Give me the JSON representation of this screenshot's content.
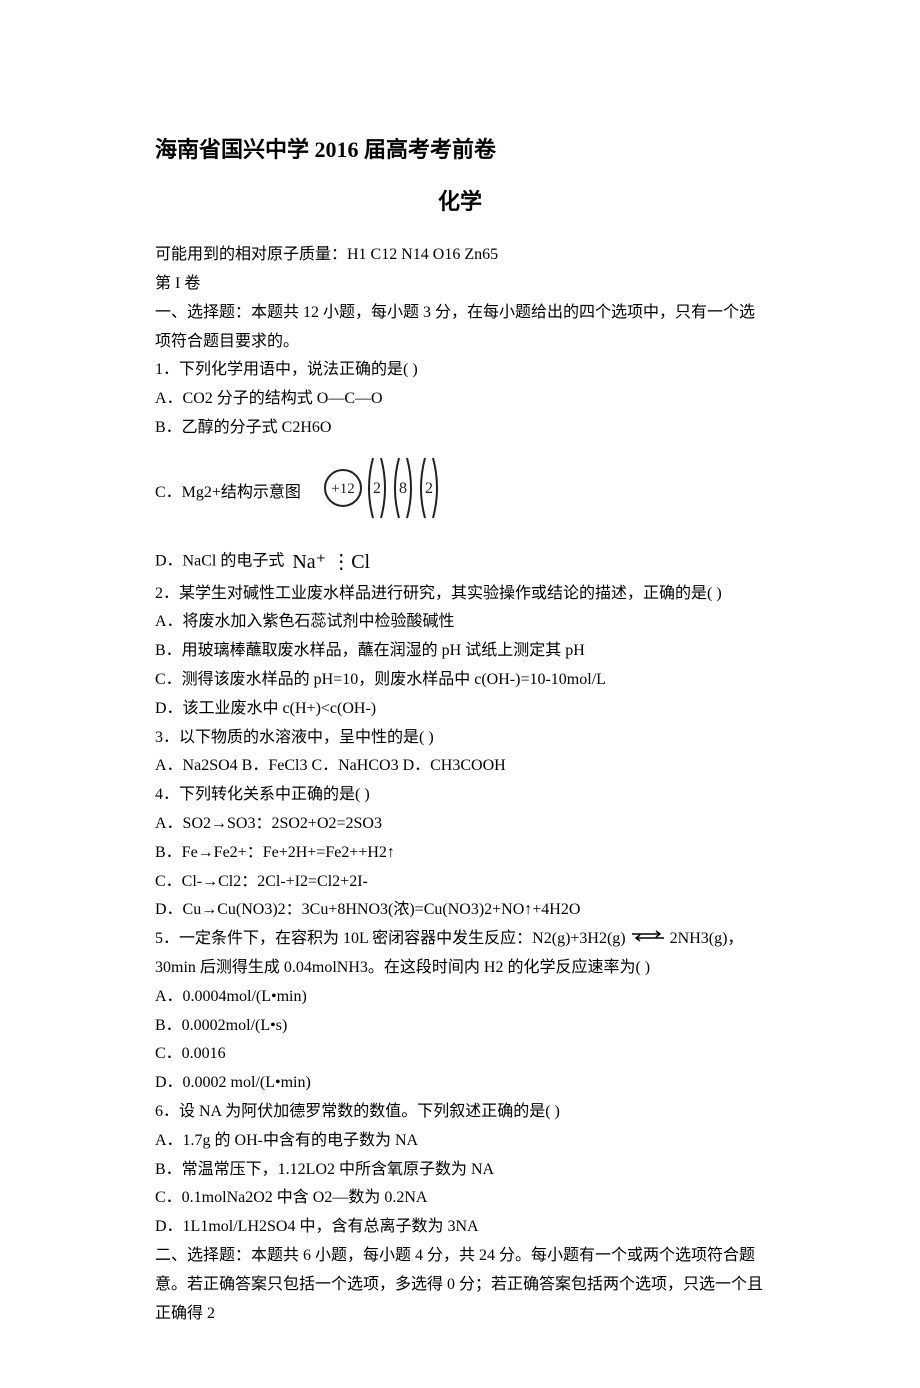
{
  "title": "海南省国兴中学 2016 届高考考前卷",
  "subject": "化学",
  "atomic_masses": "可能用到的相对原子质量：H1   C12   N14   O16   Zn65",
  "part_label": "第 I 卷",
  "section1_header": "一、选择题：本题共 12 小题，每小题 3 分，在每小题给出的四个选项中，只有一个选项符合题目要求的。",
  "q1": {
    "stem": "1．下列化学用语中，说法正确的是(       )",
    "a": "A．CO2 分子的结构式 O—C—O",
    "b": "B．乙醇的分子式 C2H6O",
    "c": "C．Mg2+结构示意图",
    "d_prefix": "D．NaCl 的电子式",
    "nacl": "Na⁺ ⋮Cl"
  },
  "q2": {
    "stem": "2．某学生对碱性工业废水样品进行研究，其实验操作或结论的描述，正确的是(       )",
    "a": "A．将废水加入紫色石蕊试剂中检验酸碱性",
    "b": "B．用玻璃棒蘸取废水样品，蘸在润湿的 pH 试纸上测定其 pH",
    "c": "C．测得该废水样品的 pH=10，则废水样品中 c(OH-)=10-10mol/L",
    "d": "D．该工业废水中 c(H+)<c(OH-)"
  },
  "q3": {
    "stem": "3．以下物质的水溶液中，呈中性的是(       )",
    "opts": "A．Na2SO4      B．FeCl3      C．NaHCO3      D．CH3COOH"
  },
  "q4": {
    "stem": "4．下列转化关系中正确的是(       )",
    "a": "A．SO2→SO3：2SO2+O2=2SO3",
    "b": "B．Fe→Fe2+：Fe+2H+=Fe2++H2↑",
    "c": "C．Cl-→Cl2：2Cl-+I2=Cl2+2I-",
    "d": "D．Cu→Cu(NO3)2：3Cu+8HNO3(浓)=Cu(NO3)2+NO↑+4H2O"
  },
  "q5": {
    "stem_part1": "5．一定条件下，在容积为 10L 密闭容器中发生反应：N2(g)+3H2(g)",
    "stem_part2": "2NH3(g)，30min 后测得生成 0.04molNH3。在这段时间内 H2 的化学反应速率为(       )",
    "a": "A．0.0004mol/(L•min)",
    "b": "B．0.0002mol/(L•s)",
    "c": "C．0.0016",
    "d": "D．0.0002 mol/(L•min)"
  },
  "q6": {
    "stem": "6．设 NA 为阿伏加德罗常数的数值。下列叙述正确的是(       )",
    "a": "A．1.7g 的 OH-中含有的电子数为 NA",
    "b": "B．常温常压下，1.12LO2 中所含氧原子数为 NA",
    "c": "C．0.1molNa2O2 中含 O2—数为 0.2NA",
    "d": "D．1L1mol/LH2SO4 中，含有总离子数为 3NA"
  },
  "section2_header": "二、选择题：本题共 6 小题，每小题 4 分，共 24 分。每小题有一个或两个选项符合题意。若正确答案只包括一个选项，多选得 0 分；若正确答案包括两个选项，只选一个且正确得 2"
}
